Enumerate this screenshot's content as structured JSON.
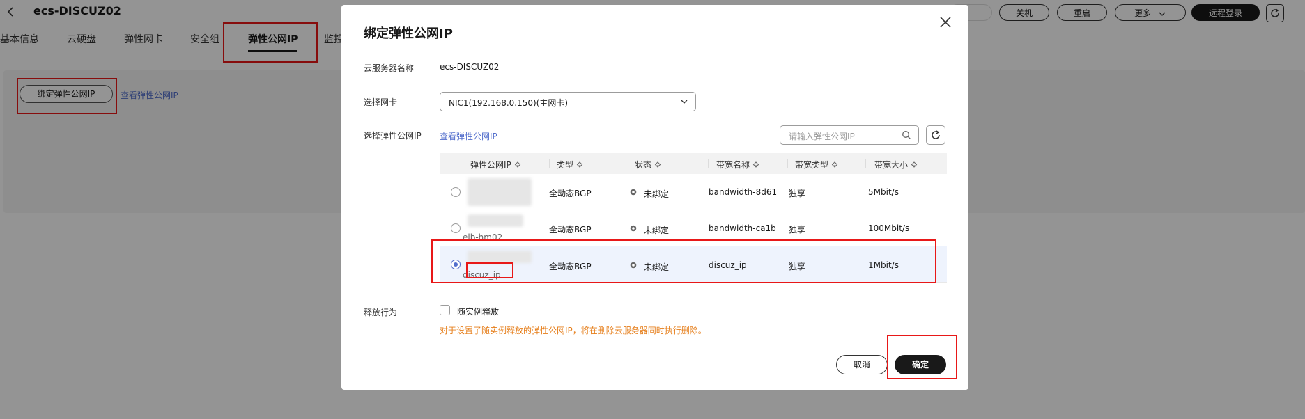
{
  "page": {
    "title": "ecs-DISCUZ02",
    "tabs": [
      "基本信息",
      "云硬盘",
      "弹性网卡",
      "安全组",
      "弹性公网IP",
      "监控"
    ],
    "header_buttons": [
      "关机",
      "重启",
      "更多",
      "远程登录"
    ],
    "bind_button": "绑定弹性公网IP",
    "view_link": "查看弹性公网IP"
  },
  "modal": {
    "title": "绑定弹性公网IP",
    "server_name_label": "云服务器名称",
    "server_name_value": "ecs-DISCUZ02",
    "nic_label": "选择网卡",
    "nic_value": "NIC1(192.168.0.150)(主网卡)",
    "eip_label": "选择弹性公网IP",
    "eip_link": "查看弹性公网IP",
    "search_placeholder": "请输入弹性公网IP",
    "columns": [
      "弹性公网IP",
      "类型",
      "状态",
      "带宽名称",
      "带宽类型",
      "带宽大小"
    ],
    "rows": [
      {
        "name": "",
        "type": "全动态BGP",
        "status": "未绑定",
        "bandwidth_name": "bandwidth-8d61",
        "bandwidth_type": "独享",
        "bandwidth_size": "5Mbit/s",
        "selected": false
      },
      {
        "name": "elb-hm02",
        "type": "全动态BGP",
        "status": "未绑定",
        "bandwidth_name": "bandwidth-ca1b",
        "bandwidth_type": "独享",
        "bandwidth_size": "100Mbit/s",
        "selected": false
      },
      {
        "name": "discuz_ip",
        "type": "全动态BGP",
        "status": "未绑定",
        "bandwidth_name": "discuz_ip",
        "bandwidth_type": "独享",
        "bandwidth_size": "1Mbit/s",
        "selected": true
      }
    ],
    "release_label": "释放行为",
    "release_checkbox": "随实例释放",
    "warning": "对于设置了随实例释放的弹性公网IP，将在删除云服务器同时执行删除。",
    "cancel": "取消",
    "ok": "确定"
  },
  "colors": {
    "accent": "#526ecc",
    "warning": "#e67e1a",
    "highlight": "#e81818",
    "primary_button": "#191919"
  }
}
